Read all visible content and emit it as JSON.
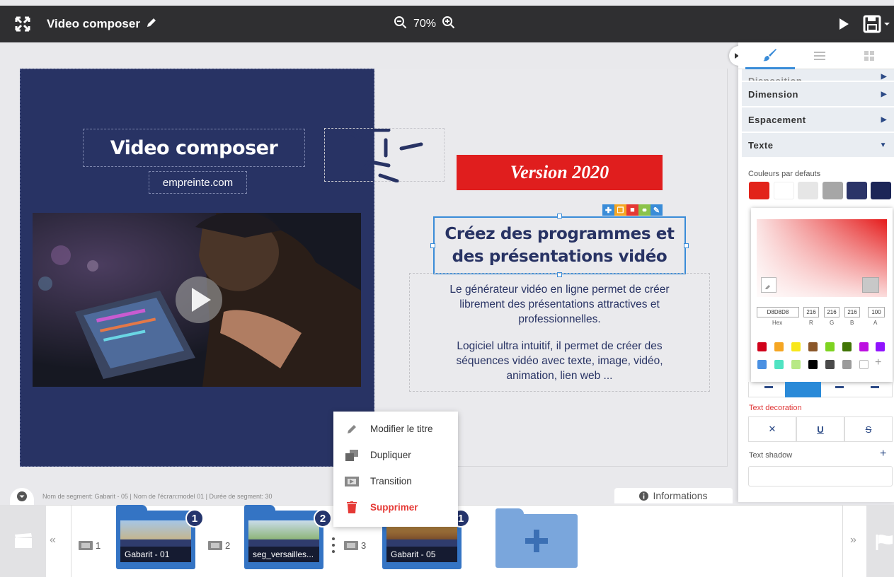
{
  "topbar": {
    "title": "Video composer",
    "zoom": "70%"
  },
  "slide": {
    "title": "Video composer",
    "url": "empreinte.com",
    "version": "Version 2020",
    "heading_line1": "Créez des programmes et",
    "heading_line2": "des présentations vidéo",
    "body_p1_l1": "Le générateur vidéo en ligne permet de créer",
    "body_p1_l2": "librement des présentations attractives et",
    "body_p1_l3": "professionnelles.",
    "body_p2_l1": "Logiciel ultra intuitif, il permet de créer des",
    "body_p2_l2": "séquences vidéo avec texte, image, vidéo,",
    "body_p2_l3": "animation, lien web ..."
  },
  "context_menu": {
    "items": [
      {
        "label": "Modifier le titre",
        "icon": "pencil-icon"
      },
      {
        "label": "Dupliquer",
        "icon": "duplicate-icon"
      },
      {
        "label": "Transition",
        "icon": "transition-icon"
      },
      {
        "label": "Supprimer",
        "icon": "trash-icon",
        "color": "#e53935"
      }
    ]
  },
  "status": {
    "segment_info": "Nom de segment: Gabarit - 05 | Nom de l'écran:model 01 | Durée de segment: 30",
    "informations": "Informations"
  },
  "timeline": {
    "segments": [
      {
        "number": "1",
        "name": "Gabarit - 01",
        "badge": "1"
      },
      {
        "number": "2",
        "name": "seg_versailles...",
        "badge": "2"
      },
      {
        "number": "3",
        "name": "Gabarit - 05",
        "badge": "1"
      }
    ],
    "prev": "«",
    "next": "»"
  },
  "panel": {
    "sections": [
      {
        "label": "Disposition"
      },
      {
        "label": "Dimension"
      },
      {
        "label": "Espacement"
      },
      {
        "label": "Texte"
      }
    ],
    "default_colors_label": "Couleurs par defauts",
    "default_colors": [
      "#e2231a",
      "#ffffff",
      "#e6e6e6",
      "#a6a6a6",
      "#2b3468",
      "#1c2657"
    ],
    "picker": {
      "hex": "D8D8D8",
      "r": "216",
      "g": "216",
      "b": "216",
      "a": "100",
      "hex_label": "Hex",
      "r_label": "R",
      "g_label": "G",
      "b_label": "B",
      "a_label": "A",
      "add": "+"
    },
    "text_decoration_label": "Text decoration",
    "text_shadow_label": "Text shadow",
    "text_shadow_add": "+"
  },
  "colors": {
    "accent": "#3474c4",
    "brand_red": "#e01e1e",
    "slide_blue": "#283364"
  }
}
